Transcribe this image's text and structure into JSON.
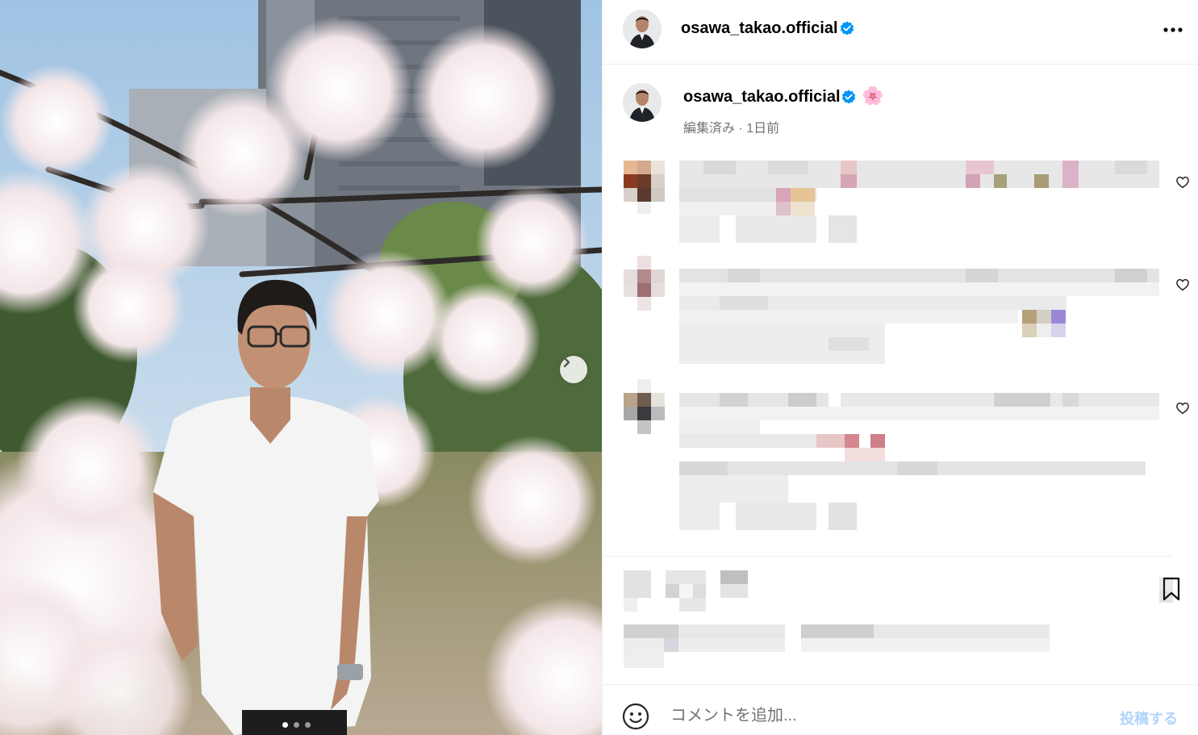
{
  "post": {
    "username": "osawa_takao.official",
    "verified": true
  },
  "caption": {
    "username": "osawa_takao.official",
    "emoji": "🌸",
    "edited": "編集済み",
    "separator": "·",
    "time": "1日前"
  },
  "carousel": {
    "dot_count": 3,
    "active_index": 0
  },
  "comment_box": {
    "placeholder": "コメントを追加...",
    "post_label": "投稿する"
  },
  "icons": {
    "more": "more-options-icon",
    "verified": "verified-badge-icon",
    "heart": "heart-icon",
    "bookmark": "bookmark-icon",
    "emoji": "emoji-icon",
    "next": "chevron-right-icon"
  },
  "colors": {
    "verified": "#0095f6",
    "post_button_disabled": "#b3d4fc",
    "secondary_text": "#737373"
  }
}
